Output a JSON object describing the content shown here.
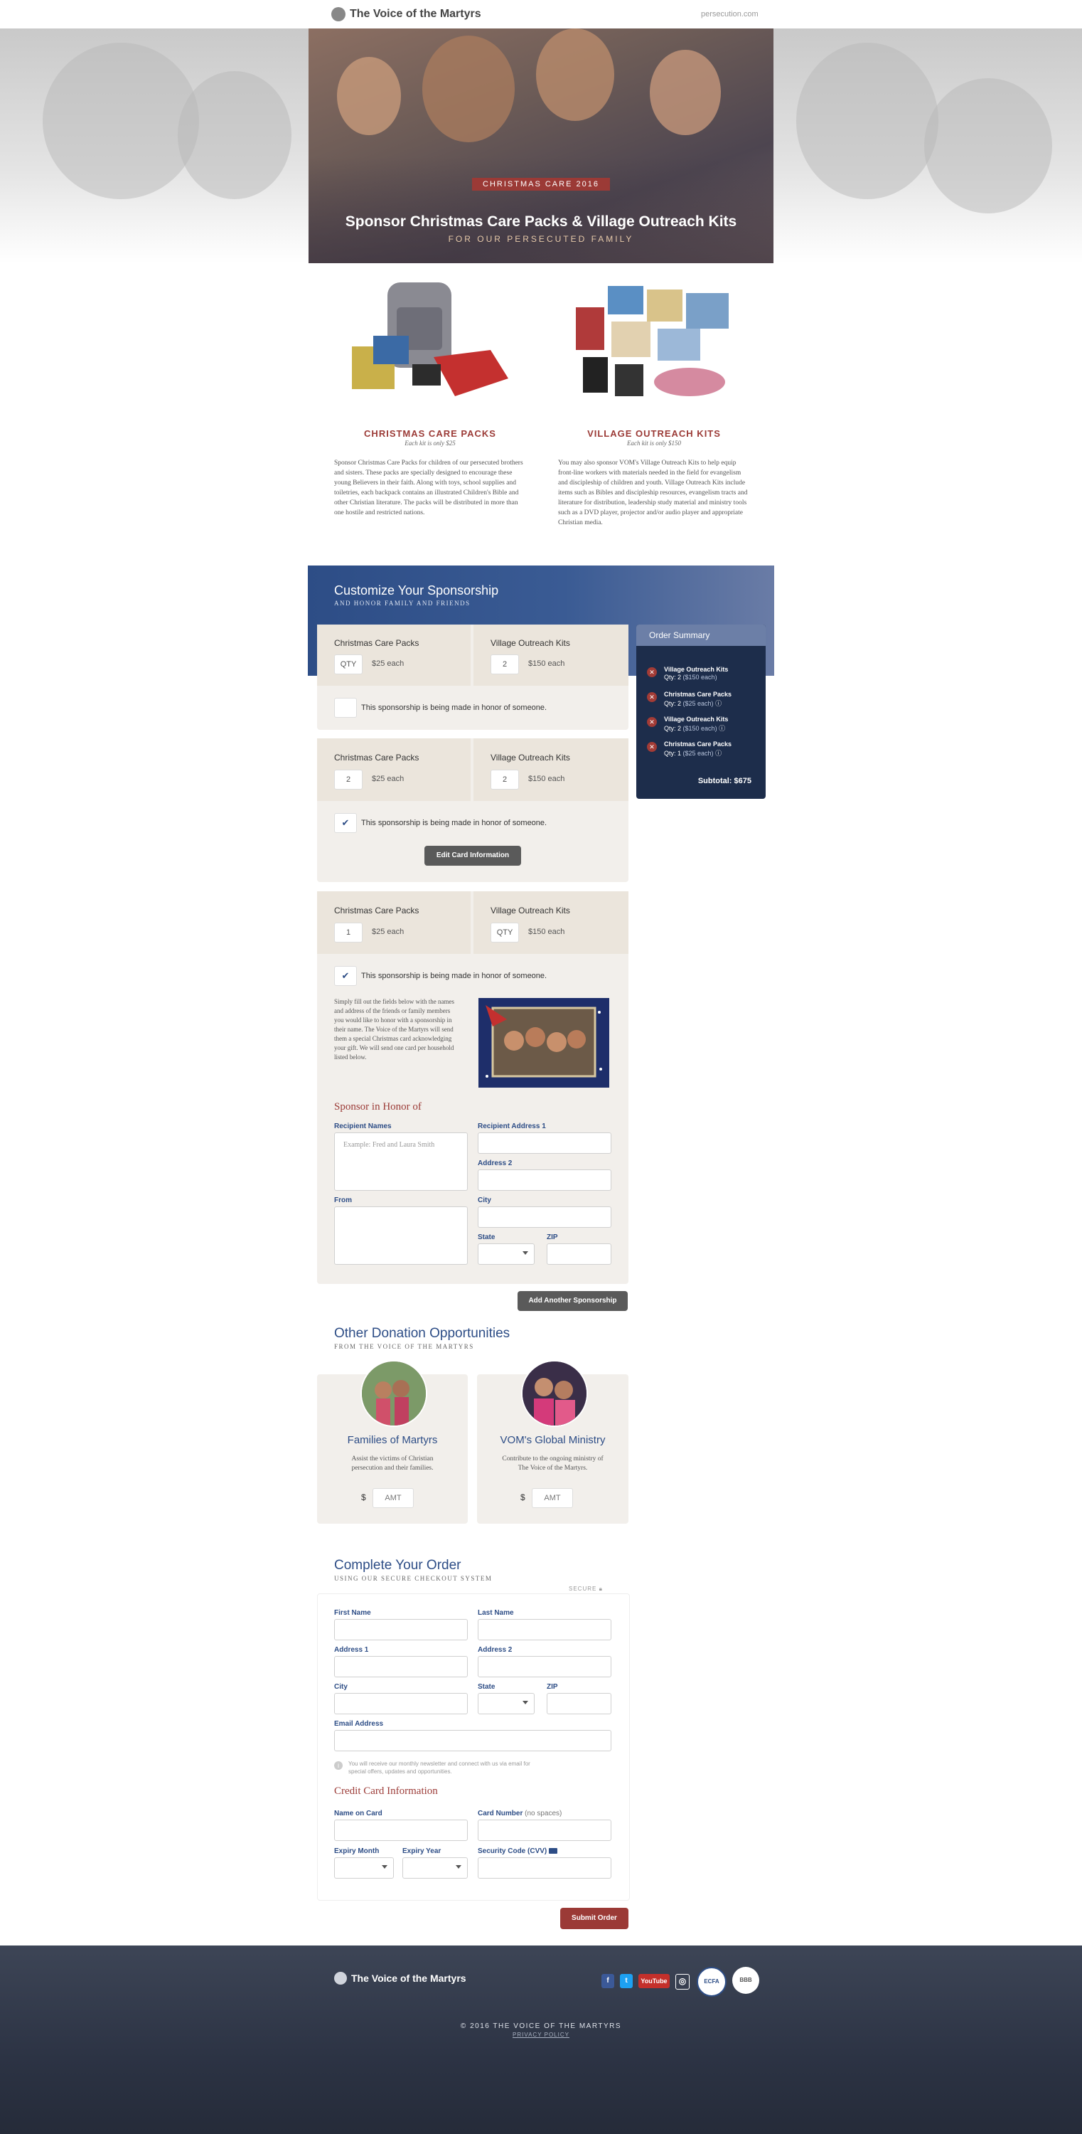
{
  "header": {
    "logo_text": "The Voice of the Martyrs",
    "site_link": "persecution.com"
  },
  "hero": {
    "tag": "CHRISTMAS CARE 2016",
    "title": "Sponsor Christmas Care Packs & Village Outreach Kits",
    "subtitle": "FOR OUR PERSECUTED FAMILY"
  },
  "products": [
    {
      "title": "CHRISTMAS CARE PACKS",
      "price_note": "Each kit is only $25",
      "description": "Sponsor Christmas Care Packs for children of our persecuted brothers and sisters. These packs are specially designed to encourage these young Believers in their faith. Along with toys, school supplies and toiletries, each backpack contains an illustrated Children's Bible and other Christian literature. The packs will be distributed in more than one hostile and restricted nations."
    },
    {
      "title": "VILLAGE OUTREACH KITS",
      "price_note": "Each kit is only $150",
      "description": "You may also sponsor VOM's Village Outreach Kits to help equip front-line workers with materials needed in the field for evangelism and discipleship of children and youth. Village Outreach Kits include items such as Bibles and discipleship resources, evangelism tracts and literature for distribution, leadership study material and ministry tools such as a DVD player, projector and/or audio player and appropriate Christian media."
    }
  ],
  "customize": {
    "title": "Customize Your Sponsorship",
    "subtitle": "AND HONOR FAMILY AND FRIENDS"
  },
  "sponsorships": [
    {
      "ccp_label": "Christmas Care Packs",
      "ccp_qty": "QTY",
      "ccp_each": "$25 each",
      "vok_label": "Village Outreach Kits",
      "vok_qty": "2",
      "vok_each": "$150 each",
      "honor": "This sponsorship is being made in honor of someone.",
      "checked": ""
    },
    {
      "ccp_label": "Christmas Care Packs",
      "ccp_qty": "2",
      "ccp_each": "$25 each",
      "vok_label": "Village Outreach Kits",
      "vok_qty": "2",
      "vok_each": "$150 each",
      "honor": "This sponsorship is being made in honor of someone.",
      "checked": "✔",
      "edit_button": "Edit Card Information"
    },
    {
      "ccp_label": "Christmas Care Packs",
      "ccp_qty": "1",
      "ccp_each": "$25 each",
      "vok_label": "Village Outreach Kits",
      "vok_qty": "QTY",
      "vok_each": "$150 each",
      "honor": "This sponsorship is being made in honor of someone.",
      "checked": "✔",
      "info": "Simply fill out the fields below with the names and address of the friends or family members you would like to honor with a sponsorship in their name. The Voice of the Martyrs will send them a special Christmas card acknowledging your gift. We will send one card per household listed below.",
      "honor_title": "Sponsor in Honor of",
      "recipient_names_label": "Recipient Names",
      "recipient_names_placeholder": "Example: Fred and Laura Smith",
      "address1_label": "Recipient Address 1",
      "address2_label": "Address 2",
      "from_label": "From",
      "city_label": "City",
      "state_label": "State",
      "zip_label": "ZIP"
    }
  ],
  "add_sponsorship_button": "Add Another Sponsorship",
  "order_summary": {
    "title": "Order Summary",
    "items": [
      {
        "name": "Village Outreach Kits",
        "qty_label": "Qty: 2",
        "price": "($150 each)"
      },
      {
        "name": "Christmas Care Packs",
        "qty_label": "Qty: 2",
        "price": "($25 each)"
      },
      {
        "name": "Village Outreach Kits",
        "qty_label": "Qty: 2",
        "price": "($150 each)"
      },
      {
        "name": "Christmas Care Packs",
        "qty_label": "Qty: 1",
        "price": "($25 each)"
      }
    ],
    "subtotal": "Subtotal: $675"
  },
  "donations": {
    "title": "Other Donation Opportunities",
    "subtitle": "FROM THE VOICE OF THE MARTYRS",
    "cards": [
      {
        "title": "Families of Martyrs",
        "description": "Assist the victims of Christian persecution and their families.",
        "currency": "$",
        "placeholder": "AMT"
      },
      {
        "title": "VOM's Global Ministry",
        "description": "Contribute to the ongoing ministry of The Voice of the Martyrs.",
        "currency": "$",
        "placeholder": "AMT"
      }
    ]
  },
  "checkout": {
    "title": "Complete Your Order",
    "subtitle": "USING OUR SECURE CHECKOUT SYSTEM",
    "secure_badge": "SECURE",
    "first_name": "First Name",
    "last_name": "Last Name",
    "address1": "Address 1",
    "address2": "Address 2",
    "city": "City",
    "state": "State",
    "zip": "ZIP",
    "email": "Email Address",
    "email_note": "You will receive our monthly newsletter and connect with us via email for special offers, updates and opportunities.",
    "cc_title": "Credit Card Information",
    "name_on_card": "Name on Card",
    "card_number": "Card Number",
    "card_number_note": "(no spaces)",
    "expiry_month": "Expiry Month",
    "expiry_year": "Expiry Year",
    "cvv": "Security Code (CVV)",
    "submit": "Submit Order"
  },
  "footer": {
    "logo_text": "The Voice of the Martyrs",
    "social": [
      "f",
      "t",
      "YouTube",
      "◎"
    ],
    "badges": [
      "ECFA",
      "BBB"
    ],
    "copyright": "© 2016 THE VOICE OF THE MARTYRS",
    "privacy": "PRIVACY POLICY"
  },
  "colors": {
    "brand_blue": "#2d4d86",
    "accent_red": "#9b3a36",
    "summary_bg": "#1d2d4b"
  }
}
